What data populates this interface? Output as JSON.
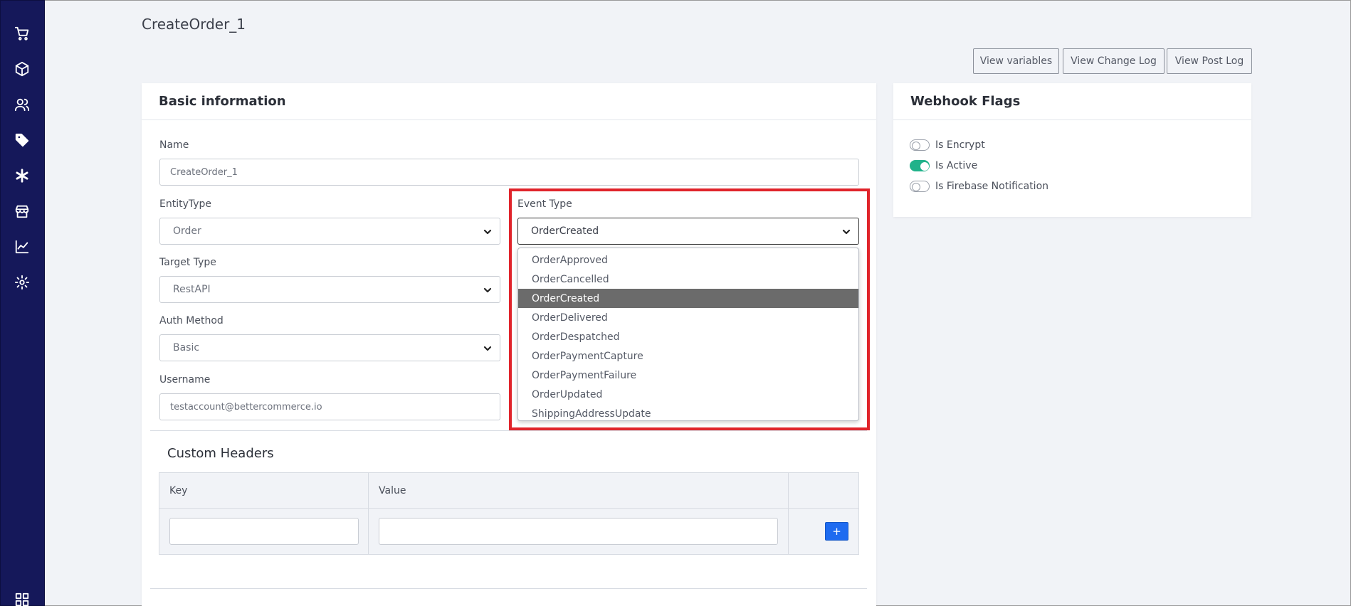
{
  "page_title": "CreateOrder_1",
  "header_buttons": {
    "view_variables": "View variables",
    "view_change_log": "View Change Log",
    "view_post_log": "View Post Log"
  },
  "sidebar": {
    "items": [
      {
        "icon": "cart-icon"
      },
      {
        "icon": "box-icon"
      },
      {
        "icon": "users-icon"
      },
      {
        "icon": "tags-icon"
      },
      {
        "icon": "asterisk-icon"
      },
      {
        "icon": "store-icon"
      },
      {
        "icon": "chart-line-icon"
      },
      {
        "icon": "gear-icon"
      },
      {
        "icon": "grid-icon"
      }
    ],
    "background": "#15185a"
  },
  "basic_info": {
    "title": "Basic information",
    "name_label": "Name",
    "name_value": "CreateOrder_1",
    "entity_type_label": "EntityType",
    "entity_type_value": "Order",
    "event_type_label": "Event Type",
    "event_type_value": "OrderCreated",
    "target_type_label": "Target Type",
    "target_type_value": "RestAPI",
    "auth_method_label": "Auth Method",
    "auth_method_value": "Basic",
    "username_label": "Username",
    "username_value": "testaccount@bettercommerce.io"
  },
  "event_type_options": [
    "OrderApproved",
    "OrderCancelled",
    "OrderCreated",
    "OrderDelivered",
    "OrderDespatched",
    "OrderPaymentCapture",
    "OrderPaymentFailure",
    "OrderUpdated",
    "ShippingAddressUpdate"
  ],
  "custom_headers": {
    "title": "Custom Headers",
    "key_header": "Key",
    "value_header": "Value",
    "add_label": "+"
  },
  "webhook_flags": {
    "title": "Webhook Flags",
    "flags": [
      {
        "label": "Is Encrypt",
        "on": false
      },
      {
        "label": "Is Active",
        "on": true
      },
      {
        "label": "Is Firebase Notification",
        "on": false
      }
    ]
  },
  "colors": {
    "accent": "#20b28a",
    "highlight": "#e0242b",
    "primary_button": "#1e6bf0"
  }
}
